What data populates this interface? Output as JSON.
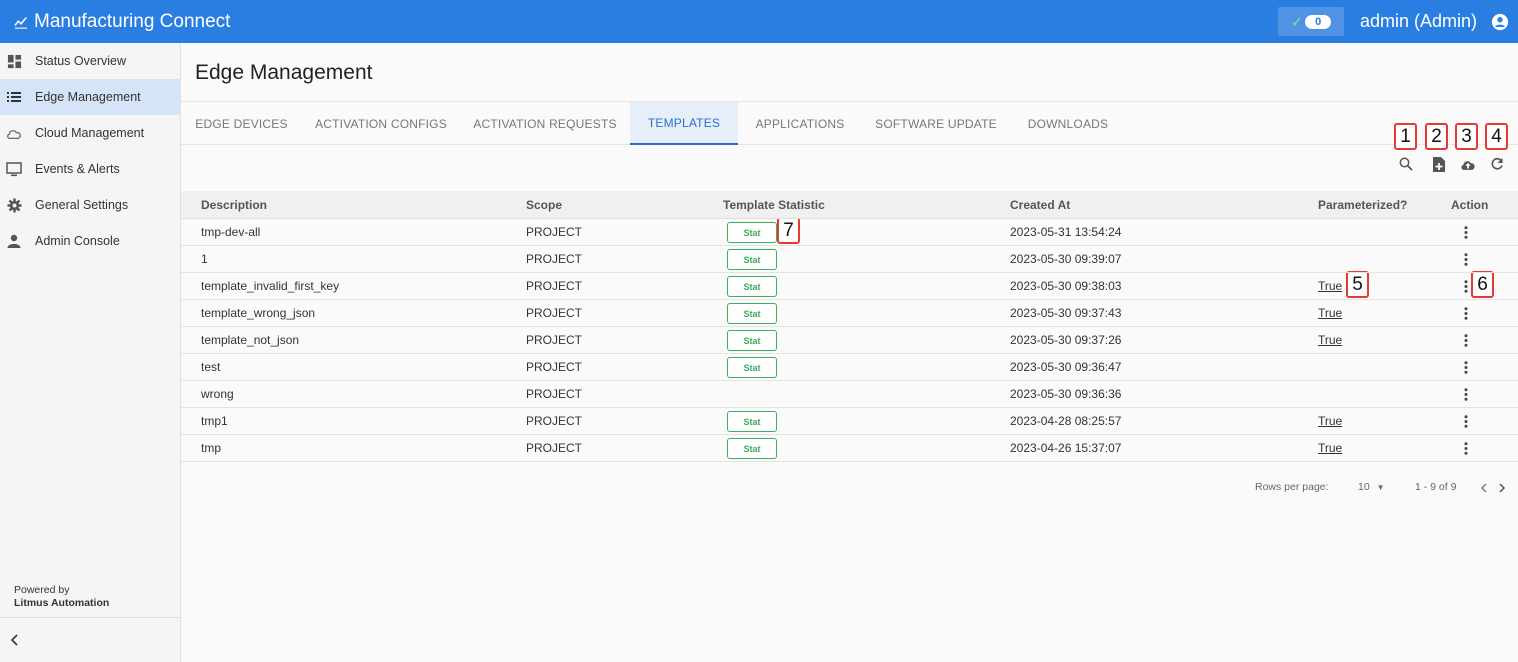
{
  "header": {
    "app_title": "Manufacturing Connect",
    "status_count": "0",
    "user_label": "admin (Admin)"
  },
  "sidebar": {
    "items": [
      {
        "label": "Status Overview",
        "icon": "dashboard-icon"
      },
      {
        "label": "Edge Management",
        "icon": "list-icon",
        "active": true
      },
      {
        "label": "Cloud Management",
        "icon": "cloud-icon"
      },
      {
        "label": "Events & Alerts",
        "icon": "monitor-icon"
      },
      {
        "label": "General Settings",
        "icon": "gear-icon"
      },
      {
        "label": "Admin Console",
        "icon": "person-icon"
      }
    ],
    "powered_by": "Powered by",
    "powered_company": "Litmus Automation"
  },
  "page": {
    "title": "Edge Management",
    "tabs": [
      "EDGE DEVICES",
      "ACTIVATION CONFIGS",
      "ACTIVATION REQUESTS",
      "TEMPLATES",
      "APPLICATIONS",
      "SOFTWARE UPDATE",
      "DOWNLOADS"
    ],
    "active_tab": "TEMPLATES"
  },
  "toolbar": {
    "icons": [
      "search-icon",
      "add-file-icon",
      "cloud-upload-icon",
      "refresh-icon"
    ]
  },
  "markers": [
    "1",
    "2",
    "3",
    "4",
    "5",
    "6",
    "7"
  ],
  "table": {
    "columns": [
      "Description",
      "Scope",
      "Template Statistic",
      "Created At",
      "Parameterized?",
      "Action"
    ],
    "stat_label": "Stat",
    "rows": [
      {
        "description": "tmp-dev-all",
        "scope": "PROJECT",
        "stat": true,
        "created": "2023-05-31 13:54:24",
        "parameterized": ""
      },
      {
        "description": "1",
        "scope": "PROJECT",
        "stat": true,
        "created": "2023-05-30 09:39:07",
        "parameterized": ""
      },
      {
        "description": "template_invalid_first_key",
        "scope": "PROJECT",
        "stat": true,
        "created": "2023-05-30 09:38:03",
        "parameterized": "True"
      },
      {
        "description": "template_wrong_json",
        "scope": "PROJECT",
        "stat": true,
        "created": "2023-05-30 09:37:43",
        "parameterized": "True"
      },
      {
        "description": "template_not_json",
        "scope": "PROJECT",
        "stat": true,
        "created": "2023-05-30 09:37:26",
        "parameterized": "True"
      },
      {
        "description": "test",
        "scope": "PROJECT",
        "stat": true,
        "created": "2023-05-30 09:36:47",
        "parameterized": ""
      },
      {
        "description": "wrong",
        "scope": "PROJECT",
        "stat": false,
        "created": "2023-05-30 09:36:36",
        "parameterized": ""
      },
      {
        "description": "tmp1",
        "scope": "PROJECT",
        "stat": true,
        "created": "2023-04-28 08:25:57",
        "parameterized": "True"
      },
      {
        "description": "tmp",
        "scope": "PROJECT",
        "stat": true,
        "created": "2023-04-26 15:37:07",
        "parameterized": "True"
      }
    ]
  },
  "pagination": {
    "rows_per_page_label": "Rows per page:",
    "rows_per_page": "10",
    "range": "1 - 9 of 9"
  }
}
